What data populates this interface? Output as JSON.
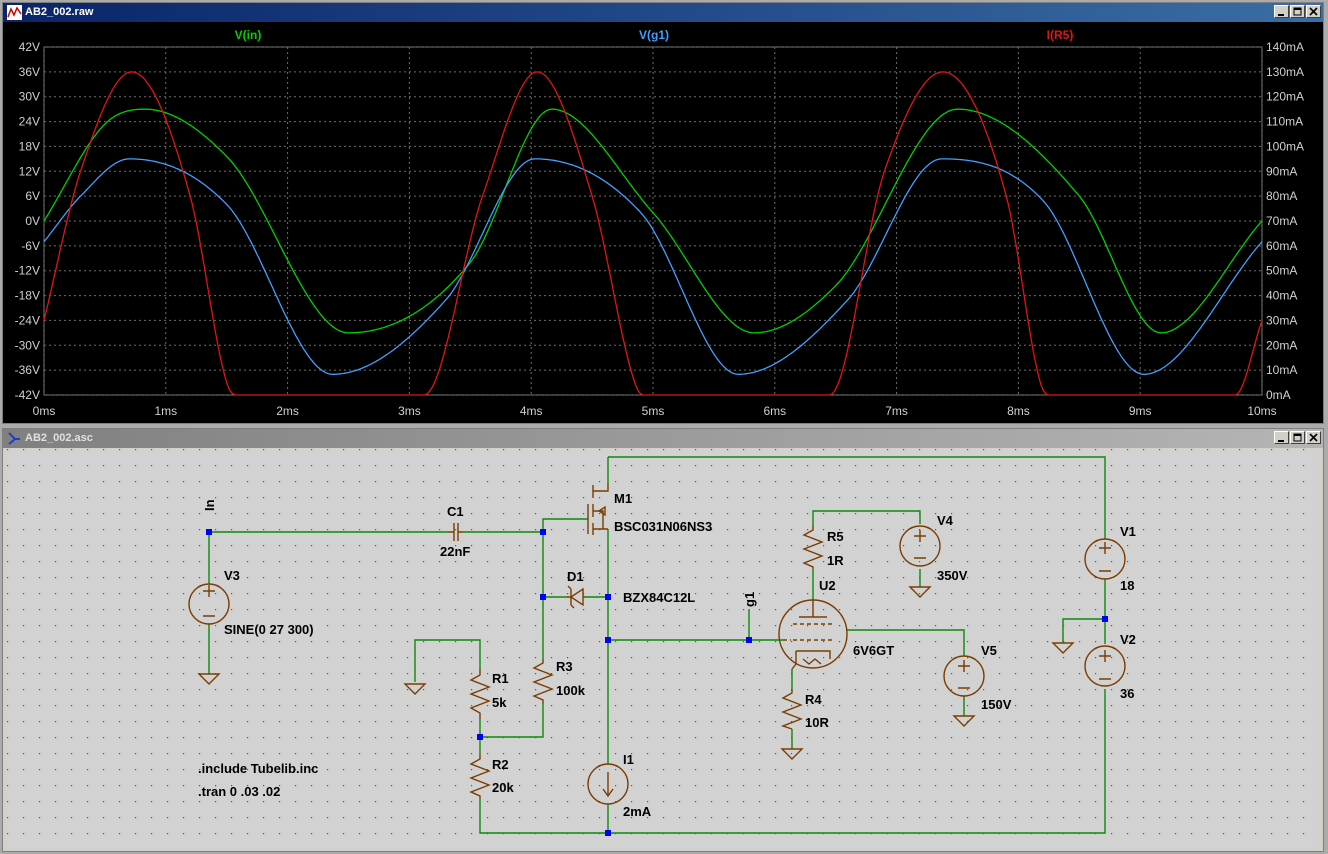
{
  "plot_window": {
    "title": "AB2_002.raw",
    "icon": "waveform-icon",
    "buttons": [
      "minimize-icon",
      "maximize-icon",
      "close-icon"
    ]
  },
  "schematic_window": {
    "title": "AB2_002.asc",
    "icon": "schematic-icon",
    "buttons": [
      "minimize-icon",
      "maximize-icon",
      "close-icon"
    ]
  },
  "chart_data": {
    "type": "line",
    "x_unit": "ms",
    "x_ticks": [
      "0ms",
      "1ms",
      "2ms",
      "3ms",
      "4ms",
      "5ms",
      "6ms",
      "7ms",
      "8ms",
      "9ms",
      "10ms"
    ],
    "xlim": [
      0,
      10
    ],
    "y_left_ticks": [
      "42V",
      "36V",
      "30V",
      "24V",
      "18V",
      "12V",
      "6V",
      "0V",
      "-6V",
      "-12V",
      "-18V",
      "-24V",
      "-30V",
      "-36V",
      "-42V"
    ],
    "ylim_left": [
      -42,
      42
    ],
    "y_right_ticks": [
      "140mA",
      "130mA",
      "120mA",
      "110mA",
      "100mA",
      "90mA",
      "80mA",
      "70mA",
      "60mA",
      "50mA",
      "40mA",
      "30mA",
      "20mA",
      "10mA",
      "0mA"
    ],
    "ylim_right": [
      0,
      140
    ],
    "grid": true,
    "series": [
      {
        "name": "V(in)",
        "color": "#00d000",
        "axis": "left",
        "x": [
          0,
          0.5,
          0.83,
          1.5,
          2.5,
          3.5,
          4.17,
          5,
          5.83,
          6.5,
          7.5,
          8.5,
          9.17,
          10
        ],
        "y": [
          0,
          23.4,
          27,
          15.6,
          -27,
          -10,
          27,
          2,
          -27,
          -15.6,
          27,
          6,
          -27,
          0
        ]
      },
      {
        "name": "V(g1)",
        "color": "#3fa0ff",
        "axis": "left",
        "x": [
          0,
          0.3,
          0.7,
          1.5,
          2.37,
          3.3,
          4.03,
          4.9,
          5.7,
          6.6,
          7.37,
          8.2,
          9.03,
          10
        ],
        "y": [
          -5,
          6,
          15,
          4,
          -37,
          -19,
          15,
          2,
          -37,
          -19,
          15,
          5,
          -37,
          -5
        ]
      },
      {
        "name": "I(R5)",
        "color": "#e01515",
        "axis": "right",
        "x": [
          0,
          0.3,
          0.72,
          1.2,
          1.5,
          1.58,
          3.12,
          3.6,
          4.05,
          4.5,
          4.85,
          4.92,
          6.45,
          6.9,
          7.38,
          7.9,
          8.18,
          8.25,
          9.78,
          10
        ],
        "y": [
          30,
          90,
          130,
          80,
          5,
          0,
          0,
          80,
          130,
          80,
          5,
          0,
          0,
          90,
          130,
          80,
          5,
          0,
          0,
          30
        ]
      }
    ]
  },
  "schematic": {
    "labels": {
      "net_in": "In",
      "net_g1": "g1",
      "c1_name": "C1",
      "c1_value": "22nF",
      "m1_name": "M1",
      "m1_value": "BSC031N06NS3",
      "d1_name": "D1",
      "d1_value": "BZX84C12L",
      "v3_name": "V3",
      "v3_value": "SINE(0 27 300)",
      "r1_name": "R1",
      "r1_value": "5k",
      "r2_name": "R2",
      "r2_value": "20k",
      "r3_name": "R3",
      "r3_value": "100k",
      "r4_name": "R4",
      "r4_value": "10R",
      "r5_name": "R5",
      "r5_value": "1R",
      "u2_name": "U2",
      "u2_value": "6V6GT",
      "v4_name": "V4",
      "v4_value": "350V",
      "v5_name": "V5",
      "v5_value": "150V",
      "v1_name": "V1",
      "v1_value": "18",
      "v2_name": "V2",
      "v2_value": "36",
      "i1_name": "I1",
      "i1_value": "2mA",
      "directive_1": ".include Tubelib.inc",
      "directive_2": ".tran 0 .03 .02"
    },
    "colors": {
      "wire": "#0a8a0a",
      "component": "#7a3c00",
      "junction": "#0000ff",
      "text": "#000000",
      "background": "#d2d2d2"
    }
  }
}
